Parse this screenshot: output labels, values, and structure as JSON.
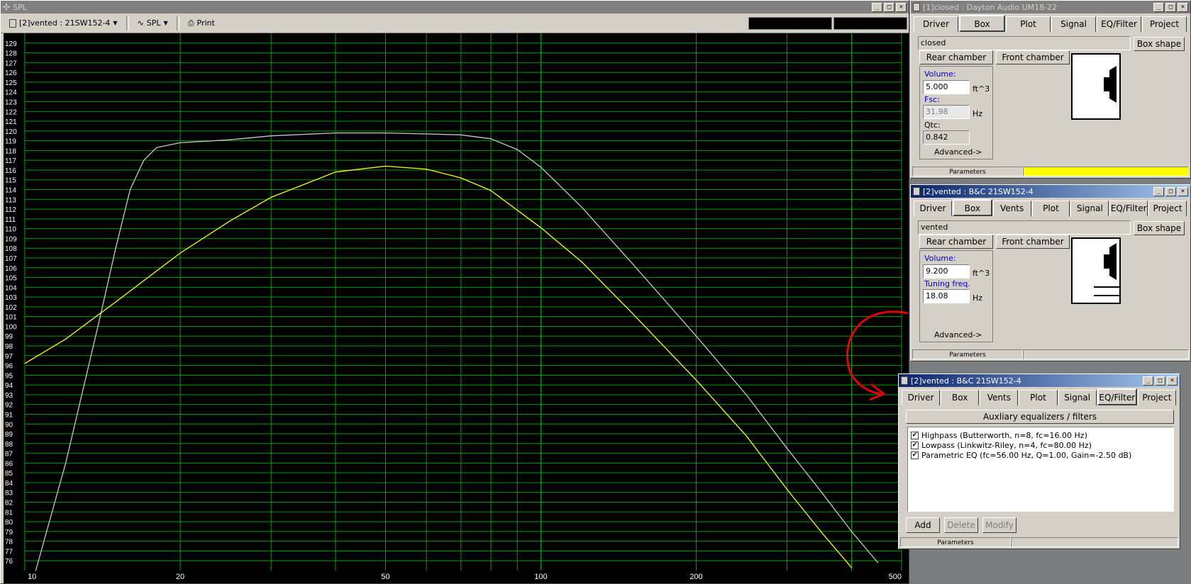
{
  "spl": {
    "title": "SPL",
    "toolbar": {
      "project_select": "[2]vented : 21SW152-4",
      "view_select": "SPL",
      "print_label": "Print"
    },
    "window_buttons": [
      "_",
      "□",
      "×"
    ]
  },
  "chart_data": {
    "type": "line",
    "xscale": "log",
    "xlim": [
      10,
      500
    ],
    "ylim": [
      75,
      130
    ],
    "x_tick_labels": [
      "10",
      "20",
      "50",
      "100",
      "200",
      "500"
    ],
    "y_tick_labels": [
      "129",
      "128",
      "127",
      "126",
      "125",
      "124",
      "123",
      "122",
      "121",
      "120",
      "119",
      "118",
      "117",
      "116",
      "115",
      "114",
      "113",
      "112",
      "111",
      "110",
      "109",
      "108",
      "107",
      "106",
      "105",
      "104",
      "103",
      "102",
      "101",
      "100",
      "99",
      "98",
      "97",
      "96",
      "95",
      "94",
      "93",
      "92",
      "91",
      "90",
      "89",
      "88",
      "87",
      "86",
      "85",
      "84",
      "83",
      "82",
      "81",
      "80",
      "79",
      "78",
      "77",
      "76"
    ],
    "grid": true,
    "background": "#000000",
    "grid_color": "#00a000",
    "series": [
      {
        "color": "#c8c8c8",
        "x": [
          10.5,
          12,
          14,
          15,
          16,
          17,
          18,
          20,
          25,
          30,
          40,
          50,
          60,
          70,
          80,
          90,
          100,
          120,
          150,
          200,
          250,
          300,
          350,
          400,
          450
        ],
        "y": [
          75,
          86,
          101,
          108,
          114,
          117,
          118.3,
          118.8,
          119.1,
          119.5,
          119.8,
          119.8,
          119.7,
          119.6,
          119.2,
          118.1,
          116.3,
          112.2,
          106.5,
          99,
          93,
          87.5,
          83,
          79,
          75.8
        ]
      },
      {
        "color": "#ffff00",
        "x": [
          10,
          12,
          15,
          20,
          25,
          30,
          40,
          50,
          60,
          70,
          80,
          100,
          120,
          150,
          200,
          250,
          300,
          350,
          400
        ],
        "y": [
          96.2,
          98.7,
          102.5,
          107.5,
          110.8,
          113.2,
          115.8,
          116.4,
          116.1,
          115.2,
          113.9,
          110.1,
          106.6,
          101.4,
          94.5,
          88.8,
          83.3,
          78.9,
          75.3
        ]
      }
    ]
  },
  "win1": {
    "title": "[1]closed : Dayton Audio UM18-22",
    "tabs": [
      "Driver",
      "Box",
      "Plot",
      "Signal",
      "EQ/Filter",
      "Project"
    ],
    "box_type": "closed",
    "box_shape_btn": "Box shape",
    "rear_chamber_btn": "Rear chamber",
    "front_chamber_btn": "Front chamber",
    "volume_label": "Volume:",
    "volume_value": "5.000",
    "volume_unit": "ft^3",
    "fsc_label": "Fsc:",
    "fsc_value": "31.98",
    "fsc_unit": "Hz",
    "qtc_label": "Qtc:",
    "qtc_value": "0.842",
    "advanced": "Advanced->",
    "status": "Parameters",
    "status_color": "#ffff00"
  },
  "win2": {
    "title": "[2]vented : B&C 21SW152-4",
    "tabs": [
      "Driver",
      "Box",
      "Vents",
      "Plot",
      "Signal",
      "EQ/Filter",
      "Project"
    ],
    "box_type": "vented",
    "box_shape_btn": "Box shape",
    "rear_chamber_btn": "Rear chamber",
    "front_chamber_btn": "Front chamber",
    "volume_label": "Volume:",
    "volume_value": "9.200",
    "volume_unit": "ft^3",
    "tuning_label": "Tuning freq.",
    "tuning_value": "18.08",
    "tuning_unit": "Hz",
    "advanced": "Advanced->",
    "status": "Parameters"
  },
  "win3": {
    "title": "[2]vented : B&C 21SW152-4",
    "tabs": [
      "Driver",
      "Box",
      "Vents",
      "Plot",
      "Signal",
      "EQ/Filter",
      "Project"
    ],
    "aux_header": "Auxliary equalizers / filters",
    "filters": [
      {
        "label": "Highpass (Butterworth, n=8, fc=16.00 Hz)",
        "checked": "✔"
      },
      {
        "label": "Lowpass (Linkwitz-Riley, n=4, fc=80.00 Hz)",
        "checked": "✔"
      },
      {
        "label": "Parametric EQ (fc=56.00 Hz, Q=1.00, Gain=-2.50 dB)",
        "checked": "✔"
      }
    ],
    "add_btn": "Add",
    "delete_btn": "Delete",
    "modify_btn": "Modify",
    "status": "Parameters"
  }
}
